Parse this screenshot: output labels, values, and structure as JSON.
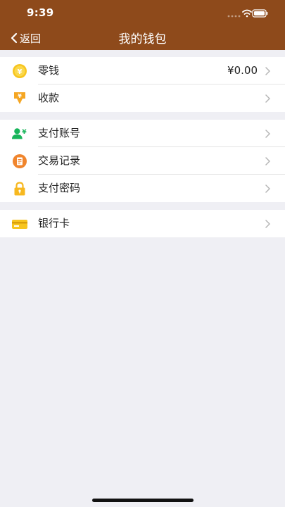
{
  "status_bar": {
    "time": "9:39"
  },
  "nav": {
    "back_label": "返回",
    "title": "我的钱包"
  },
  "groups": [
    {
      "rows": [
        {
          "icon": "coin-icon",
          "label": "零钱",
          "value": "¥0.00"
        },
        {
          "icon": "receive-money-icon",
          "label": "收款"
        }
      ]
    },
    {
      "rows": [
        {
          "icon": "payment-account-icon",
          "label": "支付账号"
        },
        {
          "icon": "transaction-record-icon",
          "label": "交易记录"
        },
        {
          "icon": "lock-icon",
          "label": "支付密码"
        }
      ]
    },
    {
      "rows": [
        {
          "icon": "bank-card-icon",
          "label": "银行卡"
        }
      ]
    }
  ],
  "colors": {
    "header": "#8e4a1b",
    "background": "#efeff4",
    "icon_orange": "#f5a623",
    "icon_green": "#18b55b",
    "icon_yellow": "#f7c51f"
  }
}
